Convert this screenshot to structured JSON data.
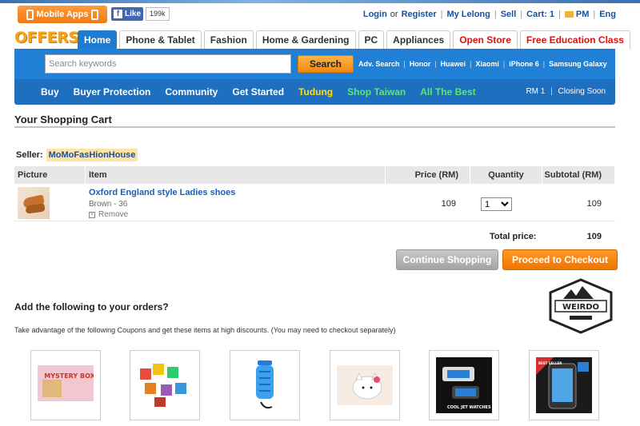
{
  "topbar": {
    "mobile_apps": "Mobile Apps",
    "fb_like": "Like",
    "fb_count": "199k",
    "login": "Login",
    "or": "or",
    "register": "Register",
    "my_lelong": "My Lelong",
    "sell": "Sell",
    "cart": "Cart: 1",
    "pm": "PM",
    "lang": "Eng"
  },
  "logo": "OFFERS",
  "tabs": [
    {
      "label": "Home"
    },
    {
      "label": "Phone & Tablet"
    },
    {
      "label": "Fashion"
    },
    {
      "label": "Home & Gardening"
    },
    {
      "label": "PC"
    },
    {
      "label": "Appliances"
    },
    {
      "label": "Open Store"
    },
    {
      "label": "Free Education Class"
    }
  ],
  "search": {
    "placeholder": "Search keywords",
    "button": "Search",
    "quicklinks": [
      "Adv. Search",
      "Honor",
      "Huawei",
      "Xiaomi",
      "iPhone 6",
      "Samsung Galaxy"
    ]
  },
  "nav": {
    "items": [
      "Buy",
      "Buyer Protection",
      "Community",
      "Get Started",
      "Tudung",
      "Shop Taiwan",
      "All The Best"
    ],
    "price": "RM 1",
    "status": "Closing Soon"
  },
  "cart": {
    "title": "Your Shopping Cart",
    "seller_label": "Seller:",
    "seller_name": "MoMoFasHionHouse",
    "columns": {
      "picture": "Picture",
      "item": "Item",
      "price": "Price (RM)",
      "quantity": "Quantity",
      "subtotal": "Subtotal (RM)"
    },
    "item": {
      "name": "Oxford England style Ladies shoes",
      "variant": "Brown - 36",
      "remove": "Remove",
      "price": "109",
      "quantity": "1",
      "subtotal": "109"
    },
    "total_label": "Total price:",
    "total_value": "109",
    "continue_button": "Continue Shopping",
    "checkout_button": "Proceed to Checkout"
  },
  "addons": {
    "title": "Add the following to your orders?",
    "description": "Take advantage of the following Coupons and get these items at high discounts. (You may need to checkout separately)",
    "badge": "WEIRDO",
    "products": [
      {
        "name": "mystery-box",
        "image_text": "MYSTERY BOX"
      },
      {
        "name": "toy-set",
        "image_text": ""
      },
      {
        "name": "insect-lamp",
        "image_text": ""
      },
      {
        "name": "hello-kitty-speaker",
        "image_text": ""
      },
      {
        "name": "led-watch",
        "image_text": "COOL JET WATCHES"
      },
      {
        "name": "screen-protector",
        "image_text": "BEST SELLER"
      }
    ]
  },
  "colors": {
    "brand_blue": "#1f80d5",
    "orange": "#f07b16",
    "link_blue": "#1a4f9c"
  }
}
